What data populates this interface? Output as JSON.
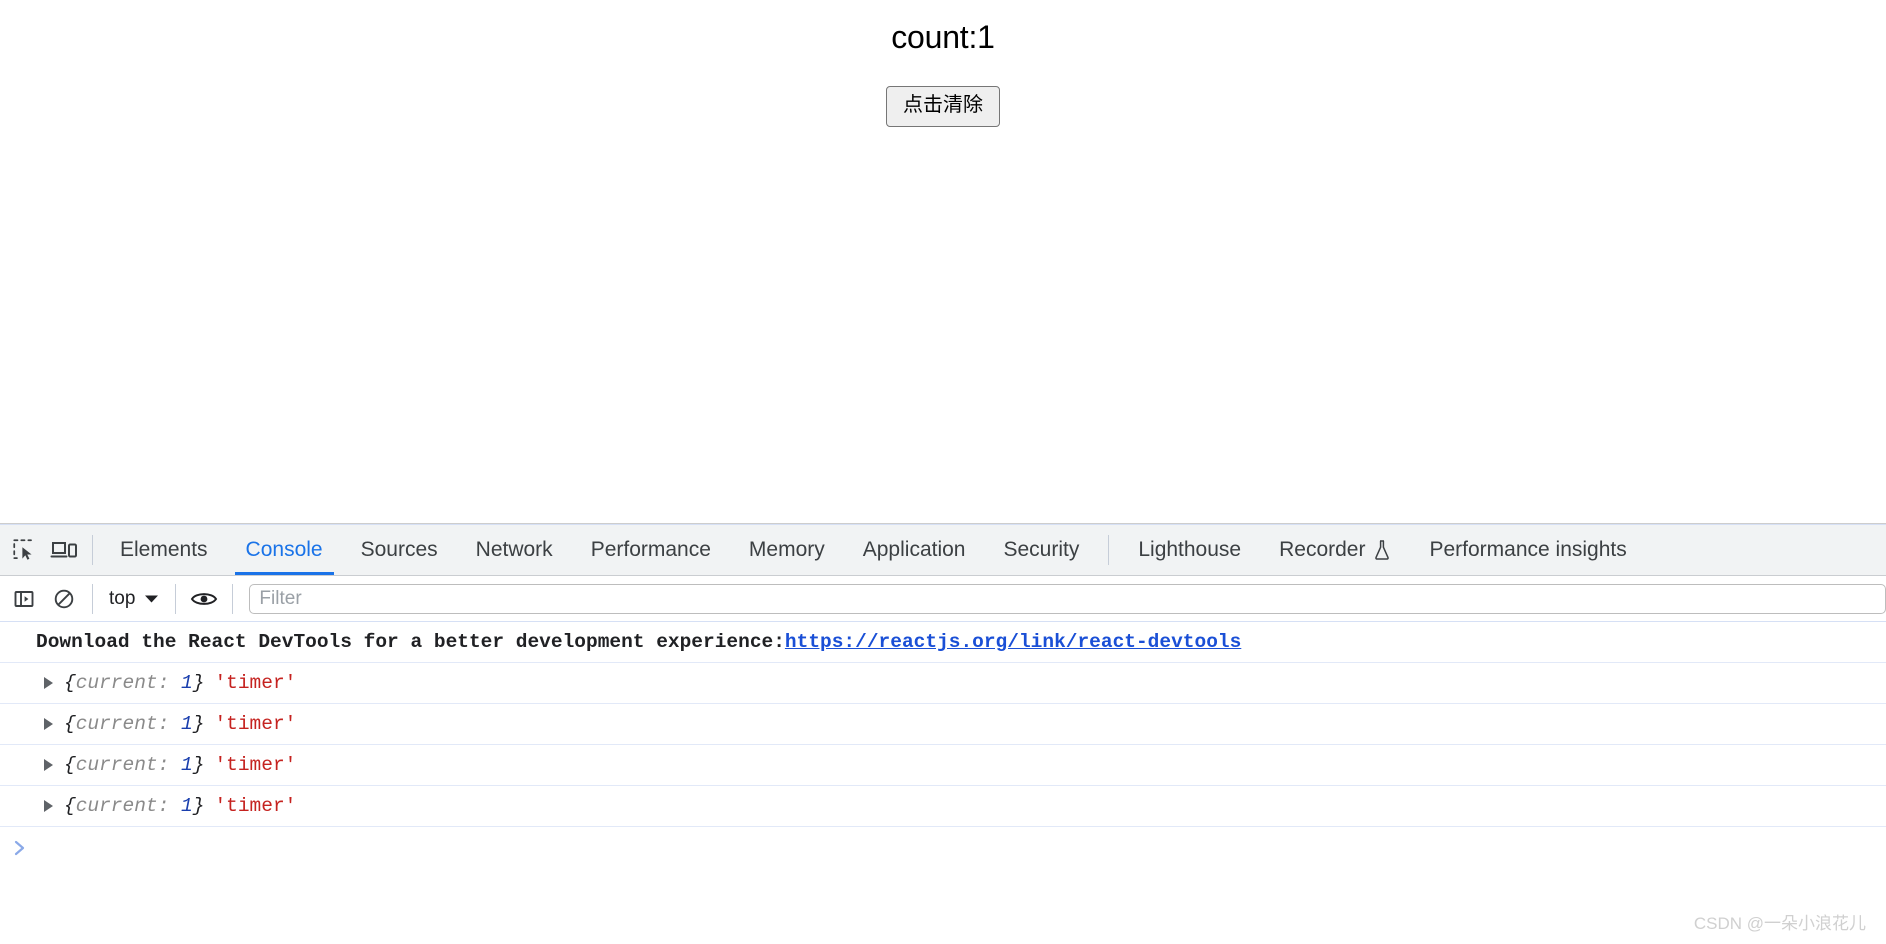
{
  "page": {
    "count_label": "count:1",
    "clear_button_label": "点击清除"
  },
  "devtools": {
    "icons": {
      "inspect": "inspect-element-icon",
      "device": "device-toolbar-icon",
      "sidebar": "console-sidebar-icon",
      "clear": "clear-console-icon",
      "eye": "live-expression-eye-icon",
      "flask": "experimental-flask-icon"
    },
    "tabs": [
      {
        "label": "Elements",
        "active": false
      },
      {
        "label": "Console",
        "active": true
      },
      {
        "label": "Sources",
        "active": false
      },
      {
        "label": "Network",
        "active": false
      },
      {
        "label": "Performance",
        "active": false
      },
      {
        "label": "Memory",
        "active": false
      },
      {
        "label": "Application",
        "active": false
      },
      {
        "label": "Security",
        "active": false
      }
    ],
    "tabs_secondary": [
      {
        "label": "Lighthouse",
        "experimental": false
      },
      {
        "label": "Recorder",
        "experimental": true
      },
      {
        "label": "Performance insights",
        "experimental": false
      }
    ],
    "toolbar": {
      "context_value": "top",
      "chevron": "▼",
      "filter_placeholder": "Filter",
      "filter_value": ""
    },
    "console": {
      "info_message": {
        "text": "Download the React DevTools for a better development experience: ",
        "link": "https://reactjs.org/link/react-devtools"
      },
      "object_rows": [
        {
          "brace_open": "{",
          "key": "current:",
          "value": "1",
          "brace_close": "}",
          "string": "'timer'"
        },
        {
          "brace_open": "{",
          "key": "current:",
          "value": "1",
          "brace_close": "}",
          "string": "'timer'"
        },
        {
          "brace_open": "{",
          "key": "current:",
          "value": "1",
          "brace_close": "}",
          "string": "'timer'"
        },
        {
          "brace_open": "{",
          "key": "current:",
          "value": "1",
          "brace_close": "}",
          "string": "'timer'"
        }
      ],
      "prompt_symbol": "❯"
    }
  },
  "watermark": "CSDN @一朵小浪花儿",
  "colors": {
    "accent_blue": "#1a73e8",
    "link_blue": "#1a4fd6",
    "string_red": "#c5221f",
    "number_blue": "#1a3fae",
    "tabbar_bg": "#f1f3f4"
  }
}
